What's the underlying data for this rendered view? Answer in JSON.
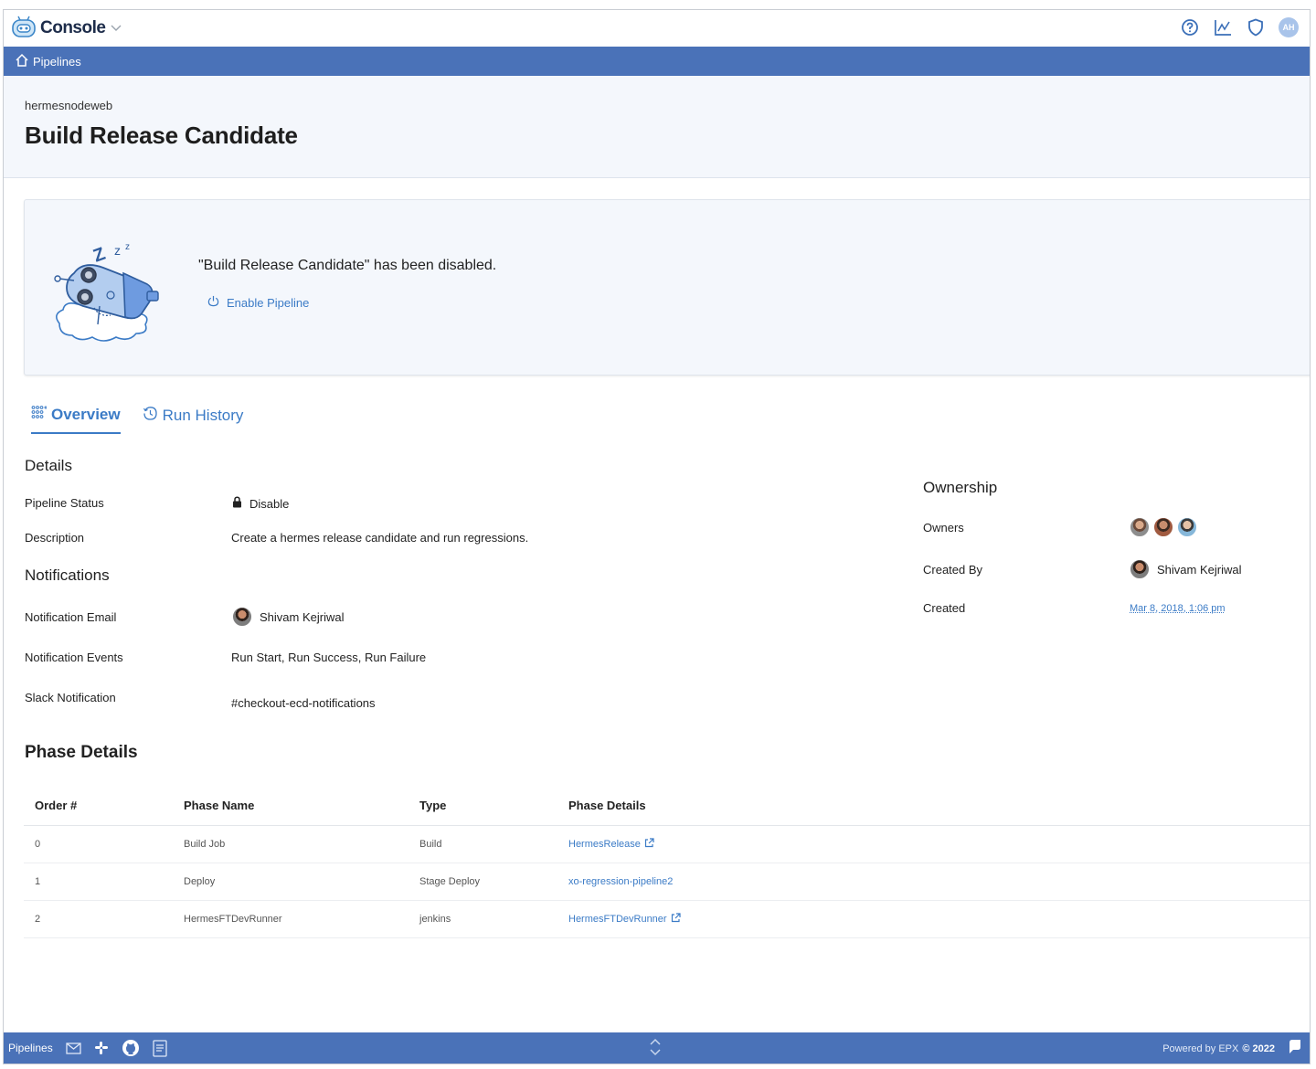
{
  "app": {
    "title": "Console"
  },
  "nav": {
    "pipelines_link": "Pipelines"
  },
  "header": {
    "project": "hermesnodeweb",
    "title": "Build Release Candidate"
  },
  "top_icons": [
    {
      "name": "help-icon"
    },
    {
      "name": "chart-icon"
    },
    {
      "name": "shield-icon"
    },
    {
      "name": "user-avatar",
      "initials": "AH"
    }
  ],
  "banner": {
    "message": "\"Build Release Candidate\" has been disabled.",
    "enable_label": "Enable Pipeline",
    "sleep_text": "Z",
    "sleep_text_2": "z",
    "sleep_text_3": "z"
  },
  "tabs": [
    {
      "label": "Overview",
      "active": true
    },
    {
      "label": "Run History",
      "active": false
    }
  ],
  "details": {
    "heading": "Details",
    "pipeline_status_label": "Pipeline Status",
    "pipeline_status_value": "Disable",
    "description_label": "Description",
    "description_value": "Create a hermes release candidate and run regressions."
  },
  "notifications": {
    "heading": "Notifications",
    "email_label": "Notification Email",
    "email_value": "Shivam Kejriwal",
    "events_label": "Notification Events",
    "events_value": "Run Start, Run Success, Run Failure",
    "slack_label": "Slack Notification",
    "slack_value": "#checkout-ecd-notifications"
  },
  "ownership": {
    "heading": "Ownership",
    "owners_label": "Owners",
    "created_by_label": "Created By",
    "created_by_value": "Shivam Kejriwal",
    "created_label": "Created",
    "created_value": "Mar 8, 2018, 1:06 pm"
  },
  "phases": {
    "heading": "Phase Details",
    "columns": [
      "Order #",
      "Phase Name",
      "Type",
      "Phase Details"
    ],
    "rows": [
      {
        "order": "0",
        "name": "Build Job",
        "type": "Build",
        "details": "HermesRelease",
        "external": true
      },
      {
        "order": "1",
        "name": "Deploy",
        "type": "Stage Deploy",
        "details": "xo-regression-pipeline2",
        "external": false
      },
      {
        "order": "2",
        "name": "HermesFTDevRunner",
        "type": "jenkins",
        "details": "HermesFTDevRunner",
        "external": true
      }
    ]
  },
  "footer": {
    "pipelines_label": "Pipelines",
    "powered_by": "Powered by EPX",
    "copyright": "© 2022"
  },
  "colors": {
    "brand_blue": "#4a72b8",
    "link_blue": "#3b7bc6",
    "header_bg": "#f4f7fc"
  }
}
